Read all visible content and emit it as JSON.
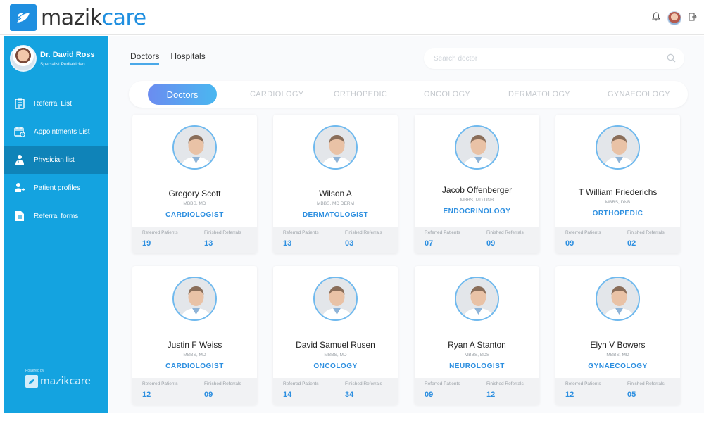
{
  "brand": {
    "name_a": "mazik",
    "name_b": "care",
    "accent": "#1f8fe0",
    "sidebar_color": "#14a3e0"
  },
  "header": {
    "icons": [
      "bell-icon",
      "user-avatar",
      "logout-icon"
    ]
  },
  "profile": {
    "name": "Dr. David Ross",
    "role": "Specialist Pediatrician"
  },
  "sidebar": {
    "items": [
      {
        "label": "Referral List",
        "icon": "clipboard-icon",
        "active": false
      },
      {
        "label": "Appointments List",
        "icon": "calendar-icon",
        "active": false
      },
      {
        "label": "Physician list",
        "icon": "physician-icon",
        "active": true
      },
      {
        "label": "Patient profiles",
        "icon": "patient-icon",
        "active": false
      },
      {
        "label": "Referral forms",
        "icon": "document-icon",
        "active": false
      }
    ],
    "powered_by": "Powered by",
    "footer_logo": "mazikcare"
  },
  "tabs": [
    {
      "label": "Doctors",
      "active": true
    },
    {
      "label": "Hospitals",
      "active": false
    }
  ],
  "search": {
    "placeholder": "Search doctor",
    "value": ""
  },
  "categories": {
    "active": "Doctors",
    "items": [
      "CARDIOLOGY",
      "ORTHOPEDIC",
      "ONCOLOGY",
      "DERMATOLOGY",
      "GYNAECOLOGY"
    ]
  },
  "stat_labels": {
    "referred": "Referred Patients",
    "finished": "Finished Referrals"
  },
  "doctors": [
    {
      "name": "Gregory Scott",
      "quals": "MBBS, MD",
      "specialty": "CARDIOLOGIST",
      "referred": "19",
      "finished": "13"
    },
    {
      "name": "Wilson A",
      "quals": "MBBS, MD DERM",
      "specialty": "DERMATOLOGIST",
      "referred": "13",
      "finished": "03"
    },
    {
      "name": "Jacob Offenberger",
      "quals": "MBBS, MD DNB",
      "specialty": "ENDOCRINOLOGY",
      "referred": "07",
      "finished": "09"
    },
    {
      "name": "T William Friederichs",
      "quals": "MBBS, DNB",
      "specialty": "ORTHOPEDIC",
      "referred": "09",
      "finished": "02"
    },
    {
      "name": "Justin F Weiss",
      "quals": "MBBS, MD",
      "specialty": "CARDIOLOGIST",
      "referred": "12",
      "finished": "09"
    },
    {
      "name": "David Samuel Rusen",
      "quals": "MBBS, MD",
      "specialty": "ONCOLOGY",
      "referred": "14",
      "finished": "34"
    },
    {
      "name": "Ryan A Stanton",
      "quals": "MBBS, BDS",
      "specialty": "NEUROLOGIST",
      "referred": "09",
      "finished": "12"
    },
    {
      "name": "Elyn V Bowers",
      "quals": "MBBS, MD",
      "specialty": "GYNAECOLOGY",
      "referred": "12",
      "finished": "05"
    }
  ]
}
